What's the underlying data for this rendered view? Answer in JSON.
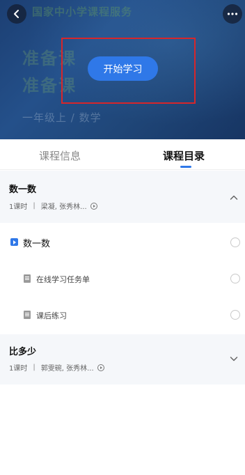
{
  "hero": {
    "title_text": "国家中小学课程服务",
    "line1": "准备课",
    "line2": "准备课",
    "subtitle": "一年级上 / 数学",
    "start_button": "开始学习"
  },
  "tabs": [
    {
      "label": "课程信息",
      "active": false
    },
    {
      "label": "课程目录",
      "active": true
    }
  ],
  "sections": [
    {
      "title": "数一数",
      "lessons_count": "1课时",
      "teachers": "梁凝, 张秀林...",
      "expanded": true,
      "items": [
        {
          "label": "数一数",
          "type": "video"
        },
        {
          "label": "在线学习任务单",
          "type": "doc"
        },
        {
          "label": "课后练习",
          "type": "doc"
        }
      ]
    },
    {
      "title": "比多少",
      "lessons_count": "1课时",
      "teachers": "郭雯碗, 张秀林...",
      "expanded": false
    }
  ],
  "colors": {
    "accent": "#2f78e8",
    "highlight": "#d7262a",
    "hero_bg": "#1f4678",
    "section_bg": "#f5f7fa"
  },
  "icons": {
    "back": "chevron-left-icon",
    "more": "more-dots-icon",
    "expand": "chevron-up-icon",
    "collapse": "chevron-down-icon",
    "play": "play-icon",
    "doc": "document-icon",
    "info": "info-play-circle-icon"
  }
}
